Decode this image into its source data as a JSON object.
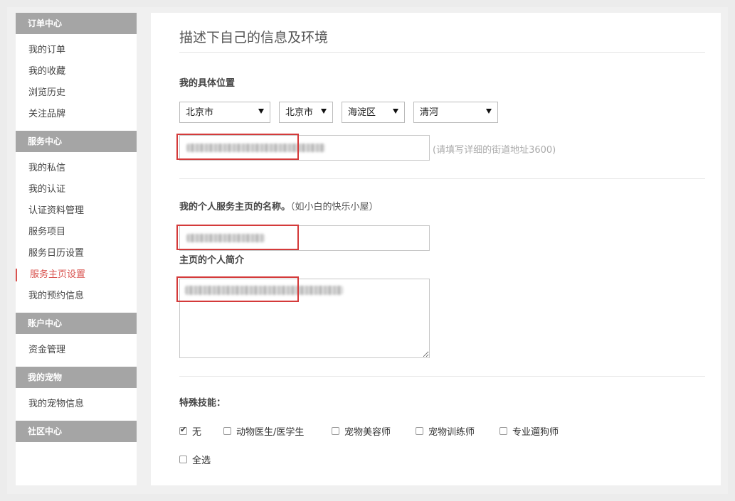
{
  "sidebar": {
    "sections": [
      {
        "title": "订单中心",
        "items": [
          "我的订单",
          "我的收藏",
          "浏览历史",
          "关注品牌"
        ]
      },
      {
        "title": "服务中心",
        "items": [
          "我的私信",
          "我的认证",
          "认证资料管理",
          "服务项目",
          "服务日历设置",
          "服务主页设置",
          "我的预约信息"
        ]
      },
      {
        "title": "账户中心",
        "items": [
          "资金管理"
        ]
      },
      {
        "title": "我的宠物",
        "items": [
          "我的宠物信息"
        ]
      },
      {
        "title": "社区中心",
        "items": []
      }
    ],
    "active_item": "服务主页设置"
  },
  "main": {
    "page_title": "描述下自己的信息及环境",
    "location": {
      "label": "我的具体位置",
      "province": "北京市",
      "city": "北京市",
      "district": "海淀区",
      "area": "清河",
      "address_help": "(请填写详细的街道地址3600)"
    },
    "homepage": {
      "label": "我的个人服务主页的名称。",
      "hint": "（如小白的快乐小屋）",
      "intro_label": "主页的个人简介"
    },
    "skills": {
      "label": "特殊技能：",
      "options": [
        {
          "label": "无",
          "checked": true
        },
        {
          "label": "动物医生/医学生",
          "checked": false
        },
        {
          "label": "宠物美容师",
          "checked": false
        },
        {
          "label": "宠物训练师",
          "checked": false
        },
        {
          "label": "专业遛狗师",
          "checked": false
        }
      ],
      "select_all": {
        "label": "全选",
        "checked": false
      }
    }
  },
  "colors": {
    "accent": "#d9534f",
    "sidebar_header": "#a5a5a5",
    "highlight_box": "#d43a3a"
  }
}
